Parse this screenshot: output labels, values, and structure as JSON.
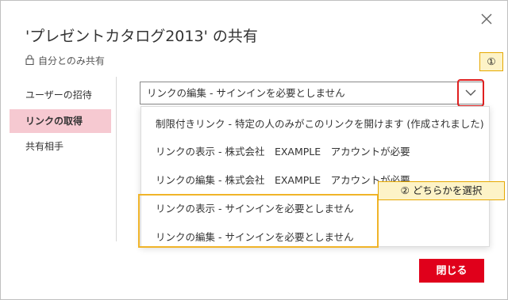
{
  "dialog": {
    "title": "'プレゼントカタログ2013' の共有",
    "privacy_label": "自分とのみ共有"
  },
  "nav": {
    "items": [
      {
        "label": "ユーザーの招待",
        "selected": false
      },
      {
        "label": "リンクの取得",
        "selected": true
      },
      {
        "label": "共有相手",
        "selected": false
      }
    ]
  },
  "link_select": {
    "selected_value": "リンクの編集 - サインインを必要としません",
    "options": [
      "制限付きリンク - 特定の人のみがこのリンクを開けます (作成されました)",
      "リンクの表示 - 株式会社　EXAMPLE　アカウントが必要",
      "リンクの編集 - 株式会社　EXAMPLE　アカウントが必要",
      "リンクの表示 - サインインを必要としません",
      "リンクの編集 - サインインを必要としません"
    ]
  },
  "annotations": {
    "step1": "①",
    "step2": "② どちらかを選択"
  },
  "footer": {
    "close_label": "閉じる"
  },
  "colors": {
    "accent": "#e0001b",
    "selected_nav_bg": "#f6c9d1",
    "annotation_border": "#f0b429",
    "annotation_fill": "#fdf3c7",
    "highlight_red": "#e02020"
  }
}
